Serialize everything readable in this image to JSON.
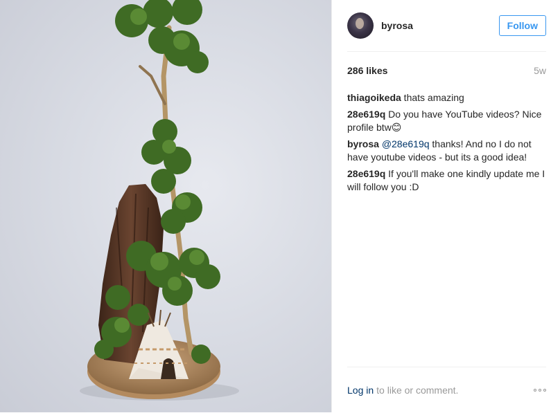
{
  "photo": {
    "subject": "miniature-tree-diorama"
  },
  "header": {
    "username": "byrosa",
    "follow_label": "Follow"
  },
  "meta": {
    "likes": "286 likes",
    "age": "5w"
  },
  "comments": [
    {
      "user": "thiagoikeda",
      "text": " thats amazing"
    },
    {
      "user": "28e619q",
      "text": " Do you have YouTube videos? Nice profile btw😊"
    },
    {
      "user": "byrosa",
      "mention": "@28e619q",
      "text": " thanks! And no I do not have youtube videos - but its a good idea!"
    },
    {
      "user": "28e619q",
      "text": " If you'll make one kindly update me I will follow you :D"
    }
  ],
  "footer": {
    "login_label": "Log in",
    "login_rest": "to like or comment."
  },
  "colors": {
    "accent": "#3897f0",
    "link": "#003569",
    "muted": "#999999",
    "text": "#262626",
    "divider": "#efefef"
  },
  "icons": {
    "more": "more-options-icon"
  }
}
